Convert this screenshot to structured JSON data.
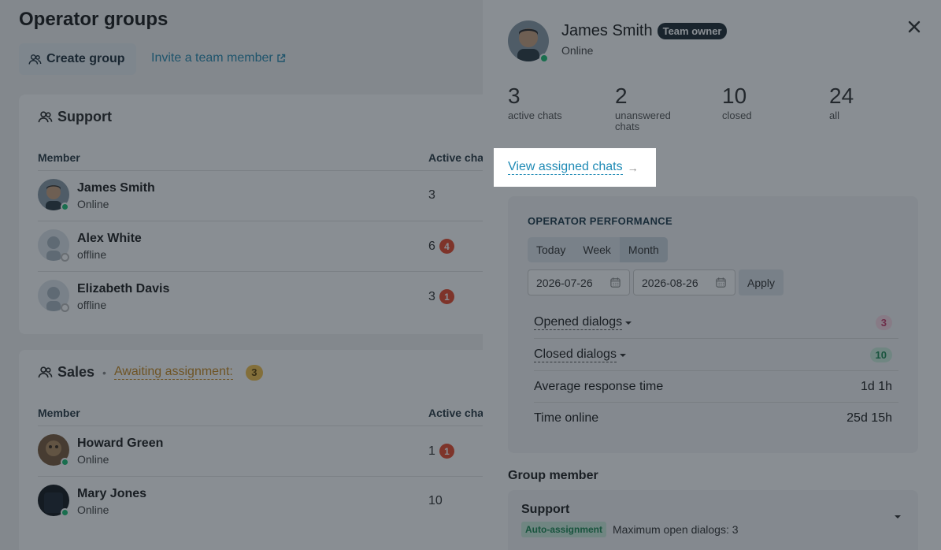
{
  "page": {
    "title": "Operator groups",
    "create_group_label": "Create group",
    "invite_label": "Invite a team member"
  },
  "groups": [
    {
      "name": "Support",
      "col_member": "Member",
      "col_active": "Active chats",
      "members": [
        {
          "name": "James Smith",
          "status": "Online",
          "online": true,
          "active": "3",
          "badge": ""
        },
        {
          "name": "Alex White",
          "status": "offline",
          "online": false,
          "active": "6",
          "badge": "4"
        },
        {
          "name": "Elizabeth Davis",
          "status": "offline",
          "online": false,
          "active": "3",
          "badge": "1"
        }
      ]
    },
    {
      "name": "Sales",
      "awaiting_label": "Awaiting assignment:",
      "awaiting_count": "3",
      "col_member": "Member",
      "col_active": "Active chats",
      "members": [
        {
          "name": "Howard Green",
          "status": "Online",
          "online": true,
          "active": "1",
          "badge": "1"
        },
        {
          "name": "Mary Jones",
          "status": "Online",
          "online": true,
          "active": "10",
          "badge": ""
        }
      ]
    }
  ],
  "drawer": {
    "name": "James Smith",
    "role": "Team owner",
    "status": "Online",
    "stats": [
      {
        "num": "3",
        "label": "active chats"
      },
      {
        "num": "2",
        "label": "unanswered chats"
      },
      {
        "num": "10",
        "label": "closed"
      },
      {
        "num": "24",
        "label": "all"
      }
    ],
    "view_chats": "View assigned chats",
    "performance": {
      "title": "OPERATOR PERFORMANCE",
      "periods": [
        "Today",
        "Week",
        "Month"
      ],
      "active_period": "Month",
      "date_from": "2026-07-26",
      "date_to": "2026-08-26",
      "apply": "Apply",
      "rows": [
        {
          "label": "Opened dialogs",
          "value": "3"
        },
        {
          "label": "Closed dialogs",
          "value": "10"
        },
        {
          "label": "Average response time",
          "value": "1d 1h"
        },
        {
          "label": "Time online",
          "value": "25d 15h"
        }
      ]
    },
    "group_member": {
      "title": "Group member",
      "group": "Support",
      "auto_badge": "Auto-assignment",
      "max_open": "Maximum open dialogs: 3"
    }
  },
  "colors": {
    "accent": "#1e8ab5",
    "online": "#1fbf75",
    "alert": "#e84a2c",
    "awaiting": "#c98a22"
  }
}
